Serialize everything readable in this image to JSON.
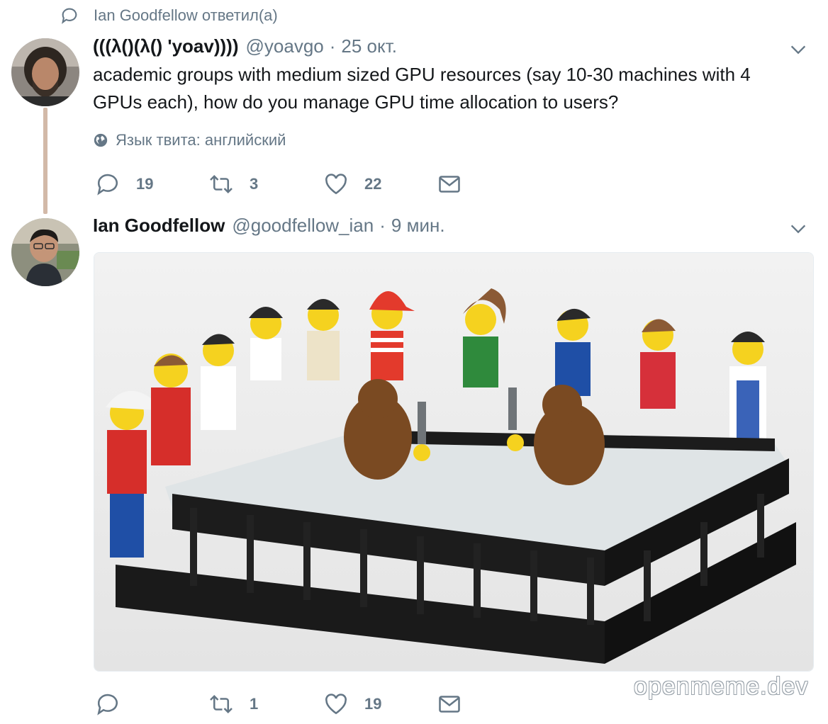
{
  "context": {
    "icon": "reply-icon",
    "text": "Ian Goodfellow ответил(а)"
  },
  "tweets": [
    {
      "author_name": "(((λ()(λ() 'yoav))))",
      "handle": "@yoavgo",
      "separator": "·",
      "time": "25 окт.",
      "text": "academic groups with medium sized GPU resources (say 10-30 machines with 4 GPUs each), how do you manage GPU time allocation to users?",
      "lang_label": "Язык твита: английский",
      "reply_count": "19",
      "retweet_count": "3",
      "like_count": "22"
    },
    {
      "author_name": "Ian Goodfellow",
      "handle": "@goodfellow_ian",
      "separator": "·",
      "time": "9 мин.",
      "media": "photo of LEGO minifigures watching two monkeys fight with knives in a black fenced arena",
      "reply_count": "",
      "retweet_count": "1",
      "like_count": "19"
    }
  ],
  "watermark": "openmeme.dev",
  "colors": {
    "secondary_text": "#657786",
    "primary_text": "#14171a",
    "thread_line": "#d2b9a8"
  }
}
